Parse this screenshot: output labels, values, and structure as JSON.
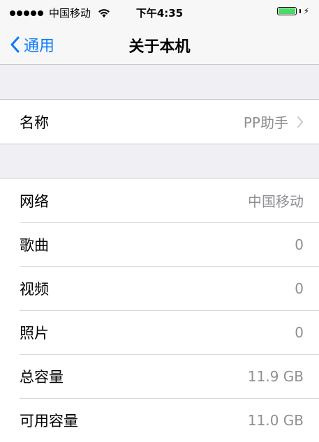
{
  "status_bar": {
    "carrier": "中国移动",
    "time": "下午4:35",
    "battery_level": 1.0,
    "battery_color": "#4cd964"
  },
  "nav": {
    "back_label": "通用",
    "title": "关于本机"
  },
  "name_row": {
    "label": "名称",
    "value": "PP助手"
  },
  "info_rows": [
    {
      "label": "网络",
      "value": "中国移动"
    },
    {
      "label": "歌曲",
      "value": "0"
    },
    {
      "label": "视频",
      "value": "0"
    },
    {
      "label": "照片",
      "value": "0"
    },
    {
      "label": "总容量",
      "value": "11.9 GB"
    },
    {
      "label": "可用容量",
      "value": "11.0 GB"
    }
  ],
  "colors": {
    "accent": "#0a7aff",
    "secondary_text": "#8e8e93"
  }
}
